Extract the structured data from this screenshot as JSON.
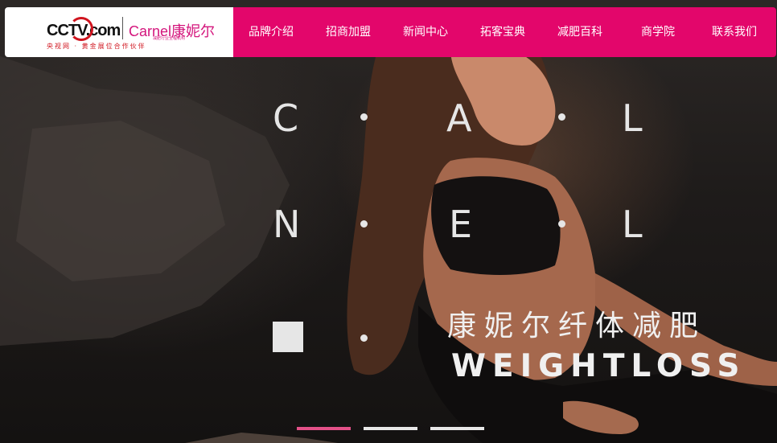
{
  "logo": {
    "cctv_text": "CCTV.com",
    "brand_text": "Carnel康妮尔",
    "brand_sub": "减肥行业全程机构",
    "tagline": "央视网 · 黄金展位合作伙伴"
  },
  "nav": {
    "items": [
      "品牌介绍",
      "招商加盟",
      "新闻中心",
      "拓客宝典",
      "减肥百科",
      "商学院",
      "联系我们"
    ]
  },
  "hero": {
    "letters": [
      "C",
      "A",
      "L",
      "N",
      "E",
      "L"
    ],
    "title_cn": "康妮尔纤体减肥",
    "title_en": "WEIGHTLOSS"
  },
  "slider": {
    "count": 3,
    "active_index": 0,
    "active_color": "#e45188"
  },
  "colors": {
    "nav_bg": "#e3066b",
    "accent": "#e45188"
  }
}
